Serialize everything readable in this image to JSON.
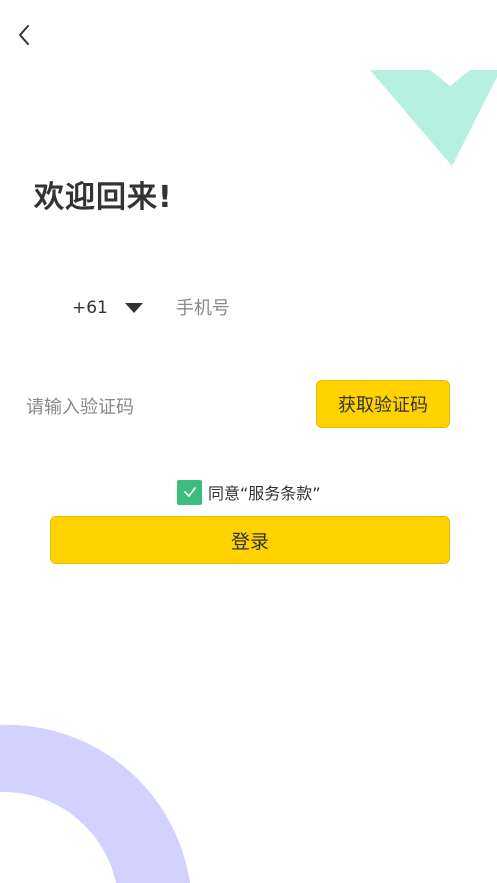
{
  "header": {
    "back_icon": "chevron-left-icon"
  },
  "welcome": {
    "title": "欢迎回来!"
  },
  "phone": {
    "country_code": "+61",
    "dropdown_icon": "triangle-down-icon",
    "placeholder": "手机号",
    "value": ""
  },
  "verification": {
    "placeholder": "请输入验证码",
    "value": "",
    "get_code_label": "获取验证码"
  },
  "agreement": {
    "checked": true,
    "label": "同意“服务条款”"
  },
  "login": {
    "label": "登录"
  },
  "colors": {
    "accent_yellow": "#ffd200",
    "checkbox_green": "#3dbd7d",
    "decor_mint": "#b5f0e0",
    "decor_lavender": "#d3d1ff",
    "text": "#333333",
    "placeholder": "#888888"
  }
}
